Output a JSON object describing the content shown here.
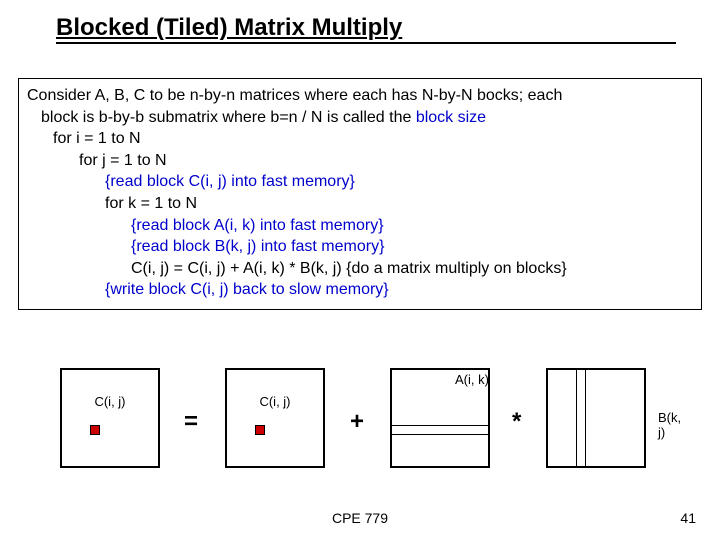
{
  "title": "Blocked (Tiled) Matrix Multiply",
  "code": {
    "l1a": "Consider A, B, C to be n-by-n matrices where each has N-by-N bocks; each",
    "l1b": "block is b-by-b submatrix where  b=n / N is called the ",
    "l1c": "block size",
    "l2": "for i = 1 to N",
    "l3": "for j = 1 to N",
    "l4": "{read block C(i, j) into fast memory}",
    "l5": "for k = 1 to N",
    "l6": "{read block A(i, k) into fast memory}",
    "l7": "{read block B(k, j) into fast memory}",
    "l8": "C(i, j) = C(i, j) + A(i, k) * B(k, j) {do a matrix multiply on blocks}",
    "l9": "{write block C(i, j) back to slow memory}"
  },
  "diagram": {
    "m1_label": "C(i, j)",
    "op1": "=",
    "m2_label": "C(i, j)",
    "op2": "+",
    "m3_label": "A(i, k)",
    "op3": "*",
    "m4_label": "B(k, j)"
  },
  "footer_center": "CPE 779",
  "footer_right": "41"
}
